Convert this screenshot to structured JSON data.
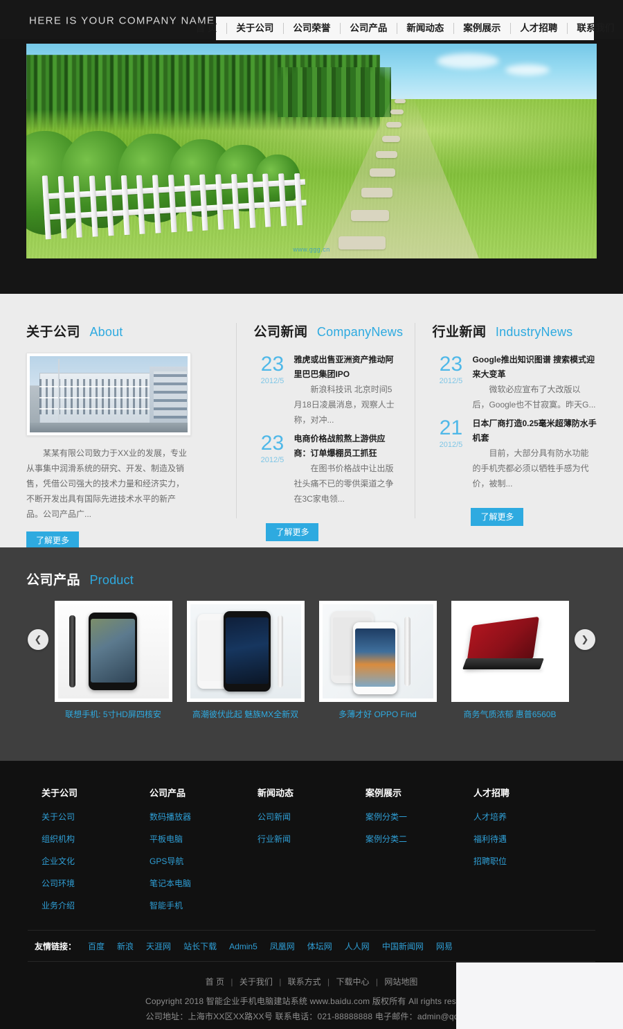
{
  "header": {
    "logo_text": "HERE IS YOUR COMPANY NAME",
    "nav": [
      {
        "label": "首 页"
      },
      {
        "label": "关于公司"
      },
      {
        "label": "公司荣誉"
      },
      {
        "label": "公司产品"
      },
      {
        "label": "新闻动态"
      },
      {
        "label": "案例展示"
      },
      {
        "label": "人才招聘"
      },
      {
        "label": "联系我们"
      }
    ]
  },
  "banner": {
    "alt": "green-field-with-stone-path-banner",
    "watermark": "www.ggg.cn"
  },
  "about": {
    "title_cn": "关于公司",
    "title_en": "About",
    "photo_alt": "company-building-photo",
    "text": "某某有限公司致力于XX业的发展，专业从事集中润滑系统的研究、开发、制造及销售，凭借公司强大的技术力量和经济实力，不断开发出具有国际先进技术水平的新产品。公司产品广...",
    "more_label": "了解更多"
  },
  "company_news": {
    "title_cn": "公司新闻",
    "title_en": "CompanyNews",
    "items": [
      {
        "day": "23",
        "ym": "2012/5",
        "title": "雅虎或出售亚洲资产推动阿里巴巴集团IPO",
        "desc": "新浪科技讯 北京时间5月18日凌晨消息，观察人士称，对冲..."
      },
      {
        "day": "23",
        "ym": "2012/5",
        "title": "电商价格战煎熬上游供应商：订单爆棚员工抓狂",
        "desc": "在图书价格战中让出版社头痛不已的零供渠道之争在3C家电领..."
      }
    ],
    "more_label": "了解更多"
  },
  "industry_news": {
    "title_cn": "行业新闻",
    "title_en": "IndustryNews",
    "items": [
      {
        "day": "23",
        "ym": "2012/5",
        "title": "Google推出知识图谱 搜索模式迎来大变革",
        "desc": "微软必应宣布了大改版以后，Google也不甘寂寞。昨天G..."
      },
      {
        "day": "21",
        "ym": "2012/5",
        "title": "日本厂商打造0.25毫米超薄防水手机套",
        "desc": "目前，大部分具有防水功能的手机壳都必须以牺牲手感为代价，被制..."
      }
    ],
    "more_label": "了解更多"
  },
  "products": {
    "title_cn": "公司产品",
    "title_en": "Product",
    "prev_icon": "chevron-left-icon",
    "next_icon": "chevron-right-icon",
    "items": [
      {
        "caption": "联想手机: 5寸HD屏四核安",
        "alt": "lenovo-phone-black"
      },
      {
        "caption": "高潮彼伏此起 魅族MX全新双",
        "alt": "meizu-mx-white-phone"
      },
      {
        "caption": "多薄才好 OPPO Find",
        "alt": "oppo-find-white-phone"
      },
      {
        "caption": "商务气质浓郁 惠普6560B",
        "alt": "hp-red-laptop"
      }
    ]
  },
  "footer": {
    "columns": [
      {
        "title": "关于公司",
        "links": [
          "关于公司",
          "组织机构",
          "企业文化",
          "公司环境",
          "业务介绍"
        ]
      },
      {
        "title": "公司产品",
        "links": [
          "数码播放器",
          "平板电脑",
          "GPS导航",
          "笔记本电脑",
          "智能手机"
        ]
      },
      {
        "title": "新闻动态",
        "links": [
          "公司新闻",
          "行业新闻"
        ]
      },
      {
        "title": "案例展示",
        "links": [
          "案例分类一",
          "案例分类二"
        ]
      },
      {
        "title": "人才招聘",
        "links": [
          "人才培养",
          "福利待遇",
          "招聘职位"
        ]
      }
    ],
    "friend_label": "友情链接：",
    "friend_links": [
      "百度",
      "新浪",
      "天涯网",
      "站长下载",
      "Admin5",
      "凤凰网",
      "体坛网",
      "人人网",
      "中国新闻网",
      "网易"
    ],
    "bottom_nav": [
      "首 页",
      "关于我们",
      "联系方式",
      "下载中心",
      "网站地图"
    ],
    "copyright": "Copyright 2018 智能企业手机电脑建站系统 www.baidu.com 版权所有 All rights reserved",
    "contact": "公司地址：上海市XX区XX路XX号 联系电话：021-88888888 电子邮件：admin@qq.com"
  },
  "colors": {
    "accent": "#2eaae0",
    "link": "#2f9fd6",
    "header_bg": "#171717",
    "section_bg": "#ececec",
    "product_bg": "#3f3f3f",
    "footer_bg": "#111111"
  }
}
